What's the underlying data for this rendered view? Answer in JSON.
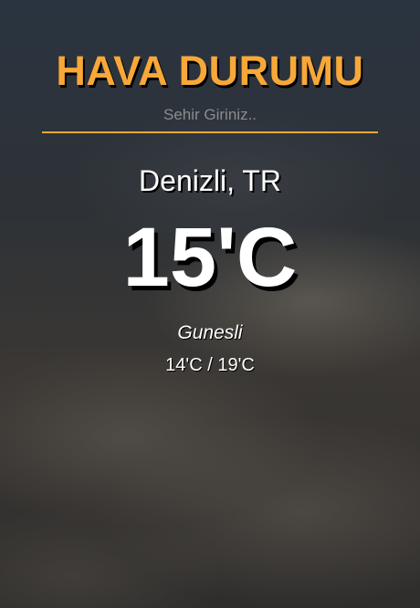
{
  "app": {
    "title": "HAVA DURUMU"
  },
  "search": {
    "placeholder": "Sehir Giriniz..",
    "value": ""
  },
  "weather": {
    "location": "Denizli, TR",
    "temperature": "15'C",
    "description": "Gunesli",
    "range": "14'C / 19'C"
  },
  "colors": {
    "accent": "#f7a838",
    "text": "#ffffff"
  }
}
